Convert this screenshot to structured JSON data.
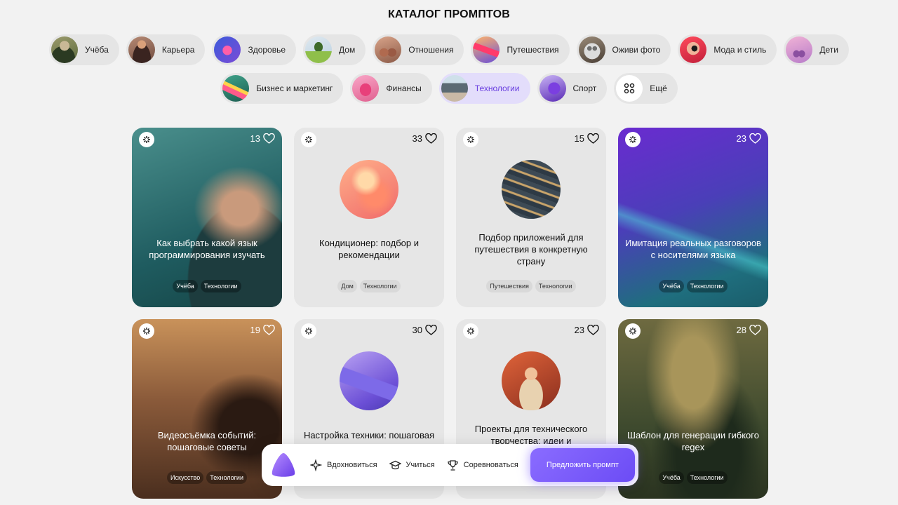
{
  "page": {
    "title": "КАТАЛОГ ПРОМПТОВ"
  },
  "categories_row1": [
    {
      "label": "Учёба",
      "icon": "study-thumb"
    },
    {
      "label": "Карьера",
      "icon": "career-thumb"
    },
    {
      "label": "Здоровье",
      "icon": "health-thumb"
    },
    {
      "label": "Дом",
      "icon": "home-thumb"
    },
    {
      "label": "Отношения",
      "icon": "relationships-thumb"
    },
    {
      "label": "Путешествия",
      "icon": "travel-thumb"
    },
    {
      "label": "Оживи фото",
      "icon": "animate-photo-thumb"
    },
    {
      "label": "Мода и стиль",
      "icon": "fashion-thumb"
    },
    {
      "label": "Дети",
      "icon": "kids-thumb"
    }
  ],
  "categories_row2": [
    {
      "label": "Бизнес и маркетинг",
      "icon": "business-thumb"
    },
    {
      "label": "Финансы",
      "icon": "finance-thumb"
    },
    {
      "label": "Технологии",
      "icon": "tech-thumb",
      "active": true
    },
    {
      "label": "Спорт",
      "icon": "sport-thumb"
    },
    {
      "label": "Ещё",
      "icon": "grid-icon"
    }
  ],
  "cards": [
    {
      "title": "Как выбрать какой язык программирования изучать",
      "likes": "13",
      "tags": [
        "Учёба",
        "Технологии"
      ]
    },
    {
      "title": "Кондиционер: подбор и рекомендации",
      "likes": "33",
      "tags": [
        "Дом",
        "Технологии"
      ]
    },
    {
      "title": "Подбор приложений для путешествия в конкретную страну",
      "likes": "15",
      "tags": [
        "Путешествия",
        "Технологии"
      ]
    },
    {
      "title": "Имитация реальных разговоров с носителями языка",
      "likes": "23",
      "tags": [
        "Учёба",
        "Технологии"
      ]
    },
    {
      "title": "Видеосъёмка событий: пошаговые советы",
      "likes": "19",
      "tags": [
        "Искусство",
        "Технологии"
      ]
    },
    {
      "title": "Настройка техники: пошаговая",
      "likes": "30",
      "tags": []
    },
    {
      "title": "Проекты для технического творчества: идеи и",
      "likes": "23",
      "tags": []
    },
    {
      "title": "Шаблон для генерации гибкого regex",
      "likes": "28",
      "tags": [
        "Учёба",
        "Технологии"
      ]
    }
  ],
  "bottom_bar": {
    "inspire": "Вдохновиться",
    "learn": "Учиться",
    "compete": "Соревноваться",
    "suggest": "Предложить промпт"
  },
  "colors": {
    "accent": "#7c5cff",
    "active_chip_bg": "#e3ddfb",
    "page_bg": "#f2f2f2"
  }
}
